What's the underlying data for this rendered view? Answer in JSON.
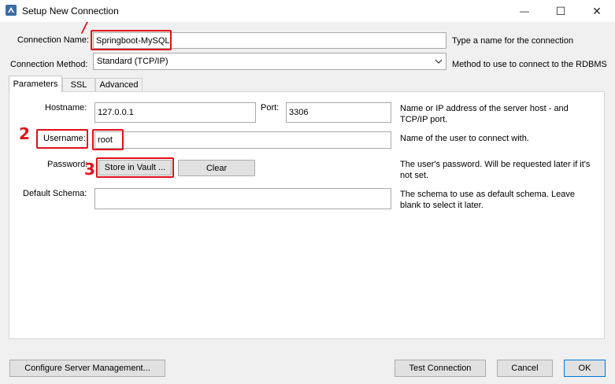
{
  "window": {
    "title": "Setup New Connection",
    "min_glyph": "—",
    "max_glyph": "☐",
    "close_glyph": "✕"
  },
  "connection_name": {
    "label": "Connection Name:",
    "value": "Springboot-MySQL",
    "help": "Type a name for the connection"
  },
  "connection_method": {
    "label": "Connection Method:",
    "value": "Standard (TCP/IP)",
    "help": "Method to use to connect to the RDBMS"
  },
  "tabs": [
    {
      "label": "Parameters",
      "active": true
    },
    {
      "label": "SSL",
      "active": false
    },
    {
      "label": "Advanced",
      "active": false
    }
  ],
  "parameters": {
    "hostname": {
      "label": "Hostname:",
      "value": "127.0.0.1"
    },
    "port": {
      "label": "Port:",
      "value": "3306"
    },
    "host_help": "Name or IP address of the server host - and TCP/IP port.",
    "username": {
      "label": "Username:",
      "value": "root",
      "help": "Name of the user to connect with."
    },
    "password": {
      "label": "Password:",
      "store_label": "Store in Vault ...",
      "clear_label": "Clear",
      "help": "The user's password. Will be requested later if it's not set."
    },
    "default_schema": {
      "label": "Default Schema:",
      "value": "",
      "help": "The schema to use as default schema. Leave blank to select it later."
    }
  },
  "annotations": {
    "one": "/",
    "two": "2",
    "three": "3"
  },
  "footer": {
    "configure_label": "Configure Server Management...",
    "test_label": "Test Connection",
    "cancel_label": "Cancel",
    "ok_label": "OK"
  },
  "colors": {
    "highlight": "#e0101a",
    "panel": "#ffffff",
    "background": "#f0f0f0"
  }
}
